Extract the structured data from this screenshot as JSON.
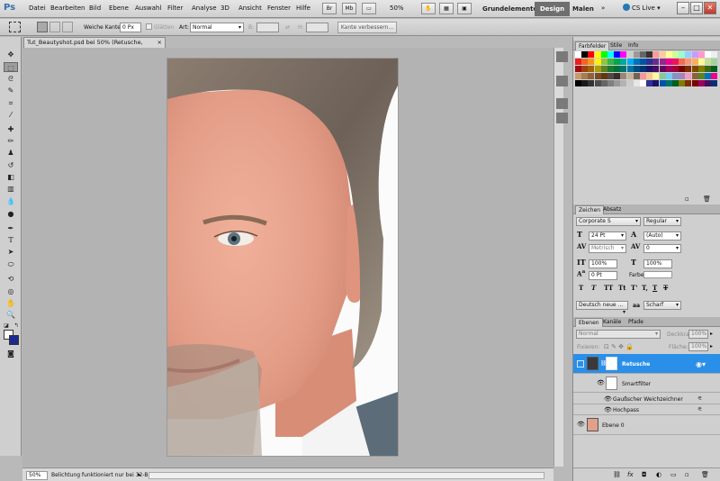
{
  "app": {
    "logo": "Ps"
  },
  "menu": [
    "Datei",
    "Bearbeiten",
    "Bild",
    "Ebene",
    "Auswahl",
    "Filter",
    "Analyse",
    "3D",
    "Ansicht",
    "Fenster",
    "Hilfe"
  ],
  "menubar": {
    "zoom": "50%",
    "workspaces": [
      "Grundelemente",
      "Design",
      "Malen"
    ],
    "active_workspace": "Design",
    "cs_live": "CS Live"
  },
  "options": {
    "soft_edge_label": "Weiche Kante:",
    "soft_edge_value": "0 Px",
    "antialias_label": "Glätten",
    "style_label": "Art:",
    "style_value": "Normal",
    "width_label": "B:",
    "height_label": "H:",
    "refine_edge": "Kante verbessern..."
  },
  "document": {
    "tab_title": "Tut_Beautyshot.psd bei 50% (Retusche, RGB/8) *",
    "status_zoom": "50%",
    "status_text": "Belichtung funktioniert nur bei 32-Bit"
  },
  "color_panel": {
    "tabs": [
      "Farbfelder",
      "Stile",
      "Info"
    ]
  },
  "char_panel": {
    "tabs": [
      "Zeichen",
      "Absatz"
    ],
    "font_family": "Corporate S",
    "font_style": "Regular",
    "font_size": "24 Pt",
    "leading": "(Auto)",
    "kerning": "Metrisch",
    "tracking": "0",
    "vscale": "100%",
    "hscale": "100%",
    "baseline": "0 Pt",
    "color_label": "Farbe:",
    "language": "Deutsch neue ...",
    "antialias_label": "aa",
    "antialias": "Scharf",
    "typo_buttons": [
      "T",
      "T",
      "TT",
      "Tt",
      "T'",
      "T,",
      "T",
      "T"
    ]
  },
  "layers_panel": {
    "tabs": [
      "Ebenen",
      "Kanäle",
      "Pfade"
    ],
    "blend_mode": "Normal",
    "opacity_label": "Deckkraft:",
    "opacity": "100%",
    "lock_label": "Fixieren:",
    "fill_label": "Fläche:",
    "fill": "100%",
    "layers": {
      "retusche": "Retusche",
      "smartfilter": "Smartfilter",
      "filter1": "Gaußscher Weichzeichner",
      "filter2": "Hochpass",
      "ebene0": "Ebene 0"
    },
    "footer_icons": [
      "link-icon",
      "fx-icon",
      "mask-icon",
      "adjustment-icon",
      "group-icon",
      "new-layer-icon",
      "trash-icon"
    ]
  },
  "colors": {
    "accent": "#2a8fe8",
    "foreground": "#ffffff",
    "background": "#1b2a8f"
  }
}
